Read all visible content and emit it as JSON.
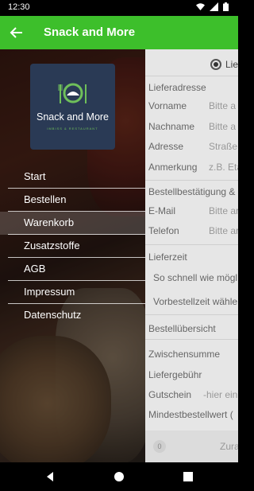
{
  "status_bar": {
    "time": "12:30"
  },
  "app_bar": {
    "title": "Snack and More"
  },
  "logo": {
    "text": "Snack and More",
    "tagline": "IMBISS & RESTAURANT"
  },
  "menu": {
    "items": [
      {
        "label": "Start"
      },
      {
        "label": "Bestellen"
      },
      {
        "label": "Warenkorb"
      },
      {
        "label": "Zusatzstoffe"
      },
      {
        "label": "AGB"
      },
      {
        "label": "Impressum"
      },
      {
        "label": "Datenschutz"
      }
    ],
    "active_index": 2
  },
  "form": {
    "delivery_option": "Lief",
    "section_address": "Lieferadresse",
    "fields": [
      {
        "label": "Vorname",
        "placeholder": "Bitte a"
      },
      {
        "label": "Nachname",
        "placeholder": "Bitte a"
      },
      {
        "label": "Adresse",
        "placeholder": "Straße,"
      },
      {
        "label": "Anmerkung",
        "placeholder": "z.B. Eta"
      }
    ],
    "section_confirm": "Bestellbestätigung &",
    "contact_fields": [
      {
        "label": "E-Mail",
        "placeholder": "Bitte ar"
      },
      {
        "label": "Telefon",
        "placeholder": "Bitte ar"
      }
    ],
    "section_time": "Lieferzeit",
    "time_options": [
      "So schnell wie mögl",
      "Vorbestellzeit wähle"
    ],
    "section_summary": "Bestellübersicht",
    "summary_rows": [
      "Zwischensumme",
      "Liefergebühr"
    ],
    "voucher_label": "Gutschein",
    "voucher_placeholder": "-hier ein",
    "min_order": "Mindestbestellwert (",
    "cart_count": "0",
    "checkout_label": "Zura"
  },
  "colors": {
    "accent": "#3dbf2b",
    "logo_bg": "#2a3a55"
  }
}
